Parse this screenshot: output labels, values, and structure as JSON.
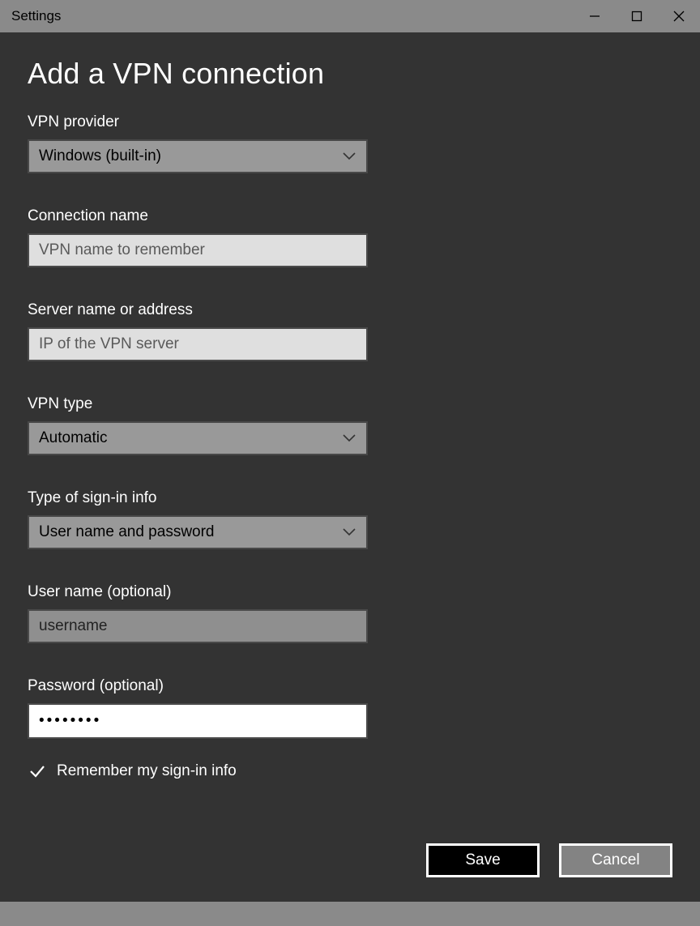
{
  "window": {
    "title": "Settings"
  },
  "page": {
    "title": "Add a VPN connection",
    "vpn_provider": {
      "label": "VPN provider",
      "value": "Windows (built-in)"
    },
    "connection_name": {
      "label": "Connection name",
      "placeholder": "VPN name to remember"
    },
    "server_address": {
      "label": "Server name or address",
      "placeholder": "IP of the VPN server"
    },
    "vpn_type": {
      "label": "VPN type",
      "value": "Automatic"
    },
    "signin_type": {
      "label": "Type of sign-in info",
      "value": "User name and password"
    },
    "username": {
      "label": "User name (optional)",
      "value": "username"
    },
    "password": {
      "label": "Password (optional)",
      "value": "••••••••"
    },
    "remember": {
      "label": "Remember my sign-in info",
      "checked": true
    },
    "buttons": {
      "save": "Save",
      "cancel": "Cancel"
    }
  }
}
